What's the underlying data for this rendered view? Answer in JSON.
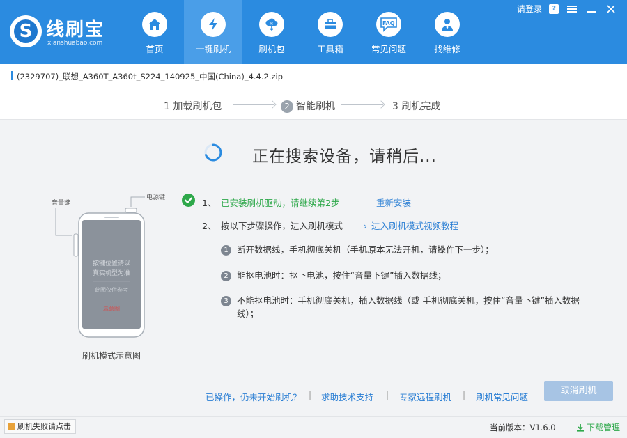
{
  "app": {
    "logo_title": "线刷宝",
    "logo_subtitle": "xianshuabao.com",
    "brand_color": "#2b8be0"
  },
  "topbar": {
    "login": "请登录",
    "help": "?",
    "menu_icon": "hamburger-icon",
    "close_icon": "close-icon"
  },
  "nav": {
    "items": [
      {
        "label": "首页",
        "icon": "home-icon"
      },
      {
        "label": "一键刷机",
        "icon": "lightning-icon"
      },
      {
        "label": "刷机包",
        "icon": "rom-package-icon"
      },
      {
        "label": "工具箱",
        "icon": "toolbox-icon"
      },
      {
        "label": "常见问题",
        "icon": "faq-icon"
      },
      {
        "label": "找维修",
        "icon": "repair-person-icon"
      }
    ],
    "faq_text": "FAQ",
    "active_index": 1
  },
  "file": {
    "path": "(2329707)_联想_A360T_A360t_S224_140925_中国(China)_4.4.2.zip"
  },
  "steps": {
    "step1": "1  加载刷机包",
    "step2_num": "2",
    "step2_label": "智能刷机",
    "step3": "3  刷机完成"
  },
  "status": {
    "searching": "正在搜索设备，请稍后..."
  },
  "phone": {
    "volume_key": "音量键",
    "power_key": "电源键",
    "screen_line1": "按键位置请以",
    "screen_line2": "真实机型为准",
    "screen_line3": "此图仅供参考",
    "screen_line4": "示意图",
    "caption": "刷机模式示意图"
  },
  "instructions": {
    "item1_num": "1、",
    "item1_text": "已安装刷机驱动，请继续第2步",
    "item1_link": "重新安装",
    "item2_num": "2、",
    "item2_text": "按以下步骤操作，进入刷机模式",
    "item2_link": "进入刷机模式视频教程",
    "sub1_num": "1",
    "sub1_text": "断开数据线，手机彻底关机（手机原本无法开机，请操作下一步）；",
    "sub2_num": "2",
    "sub2_text": "能抠电池时：抠下电池，按住“音量下键”插入数据线；",
    "sub3_num": "3",
    "sub3_line1": "不能抠电池时：手机彻底关机，插入数据线（或 手机彻底关机，按住“音量下键”插入数据",
    "sub3_line2": "线）；"
  },
  "bottom": {
    "link1": "已操作，仍未开始刷机？",
    "link2": "求助技术支持",
    "link3": "专家远程刷机",
    "link4": "刷机常见问题",
    "separator": "|",
    "cancel": "取消刷机"
  },
  "statusbar": {
    "fail_report": "刷机失败请点击",
    "version": "当前版本：V1.6.0",
    "download_mgr": "下载管理"
  }
}
